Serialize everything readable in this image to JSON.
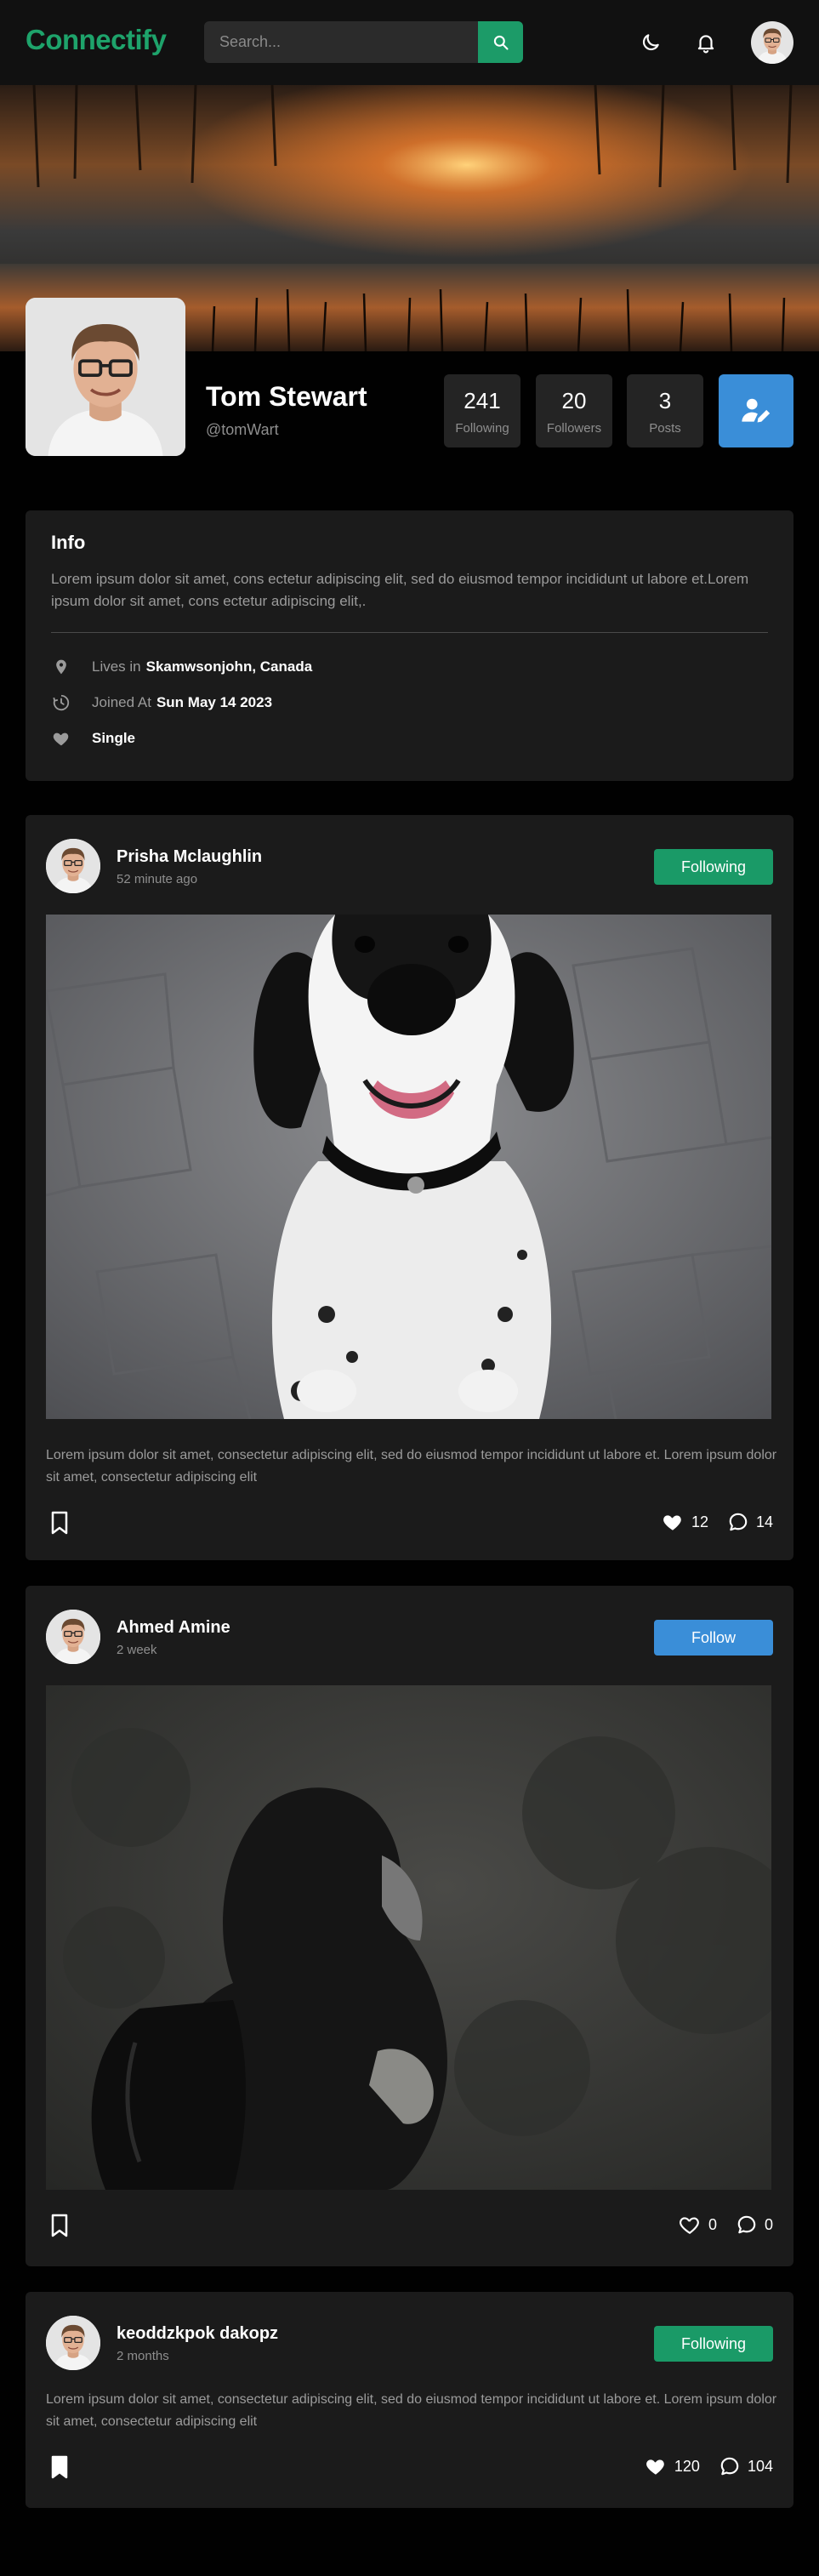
{
  "app": {
    "name": "Connectify"
  },
  "search": {
    "placeholder": "Search..."
  },
  "header": {
    "icons": [
      "moon-icon",
      "bell-icon",
      "user-avatar"
    ]
  },
  "profile": {
    "name": "Tom Stewart",
    "handle": "@tomWart",
    "stats": [
      {
        "value": "241",
        "label": "Following"
      },
      {
        "value": "20",
        "label": "Followers"
      },
      {
        "value": "3",
        "label": "Posts"
      }
    ]
  },
  "info": {
    "title": "Info",
    "description": "Lorem ipsum dolor sit amet, cons ectetur adipiscing elit, sed do eiusmod tempor incididunt ut labore et.Lorem ipsum dolor sit amet, cons ectetur adipiscing elit,.",
    "lives_prefix": "Lives in",
    "lives_value": "Skamwsonjohn, Canada",
    "joined_prefix": "Joined At",
    "joined_value": "Sun May 14 2023",
    "relationship": "Single"
  },
  "posts": [
    {
      "author": "Prisha Mclaughlin",
      "time": "52 minute ago",
      "follow_label": "Following",
      "text": "Lorem ipsum dolor sit amet, consectetur adipiscing elit, sed do eiusmod tempor incididunt ut labore et. Lorem ipsum dolor sit amet, consectetur adipiscing elit",
      "likes": "12",
      "comments": "14",
      "liked": true,
      "bookmarked": false,
      "image": "dog-photo"
    },
    {
      "author": "Ahmed Amine",
      "time": "2 week",
      "follow_label": "Follow",
      "text": "",
      "likes": "0",
      "comments": "0",
      "liked": false,
      "bookmarked": false,
      "image": "hooded-person-photo"
    },
    {
      "author": "keoddzkpok dakopz",
      "time": "2 months",
      "follow_label": "Following",
      "text": "Lorem ipsum dolor sit amet, consectetur adipiscing elit, sed do eiusmod tempor incididunt ut labore et. Lorem ipsum dolor sit amet, consectetur adipiscing elit",
      "likes": "120",
      "comments": "104",
      "liked": true,
      "bookmarked": true,
      "image": ""
    }
  ],
  "colors": {
    "brand": "#1ea36b",
    "following_button": "#1a9a67",
    "follow_button": "#3a8ed8",
    "edit_button": "#3a8ed8",
    "background": "#010101",
    "card": "#1b1b1b"
  }
}
